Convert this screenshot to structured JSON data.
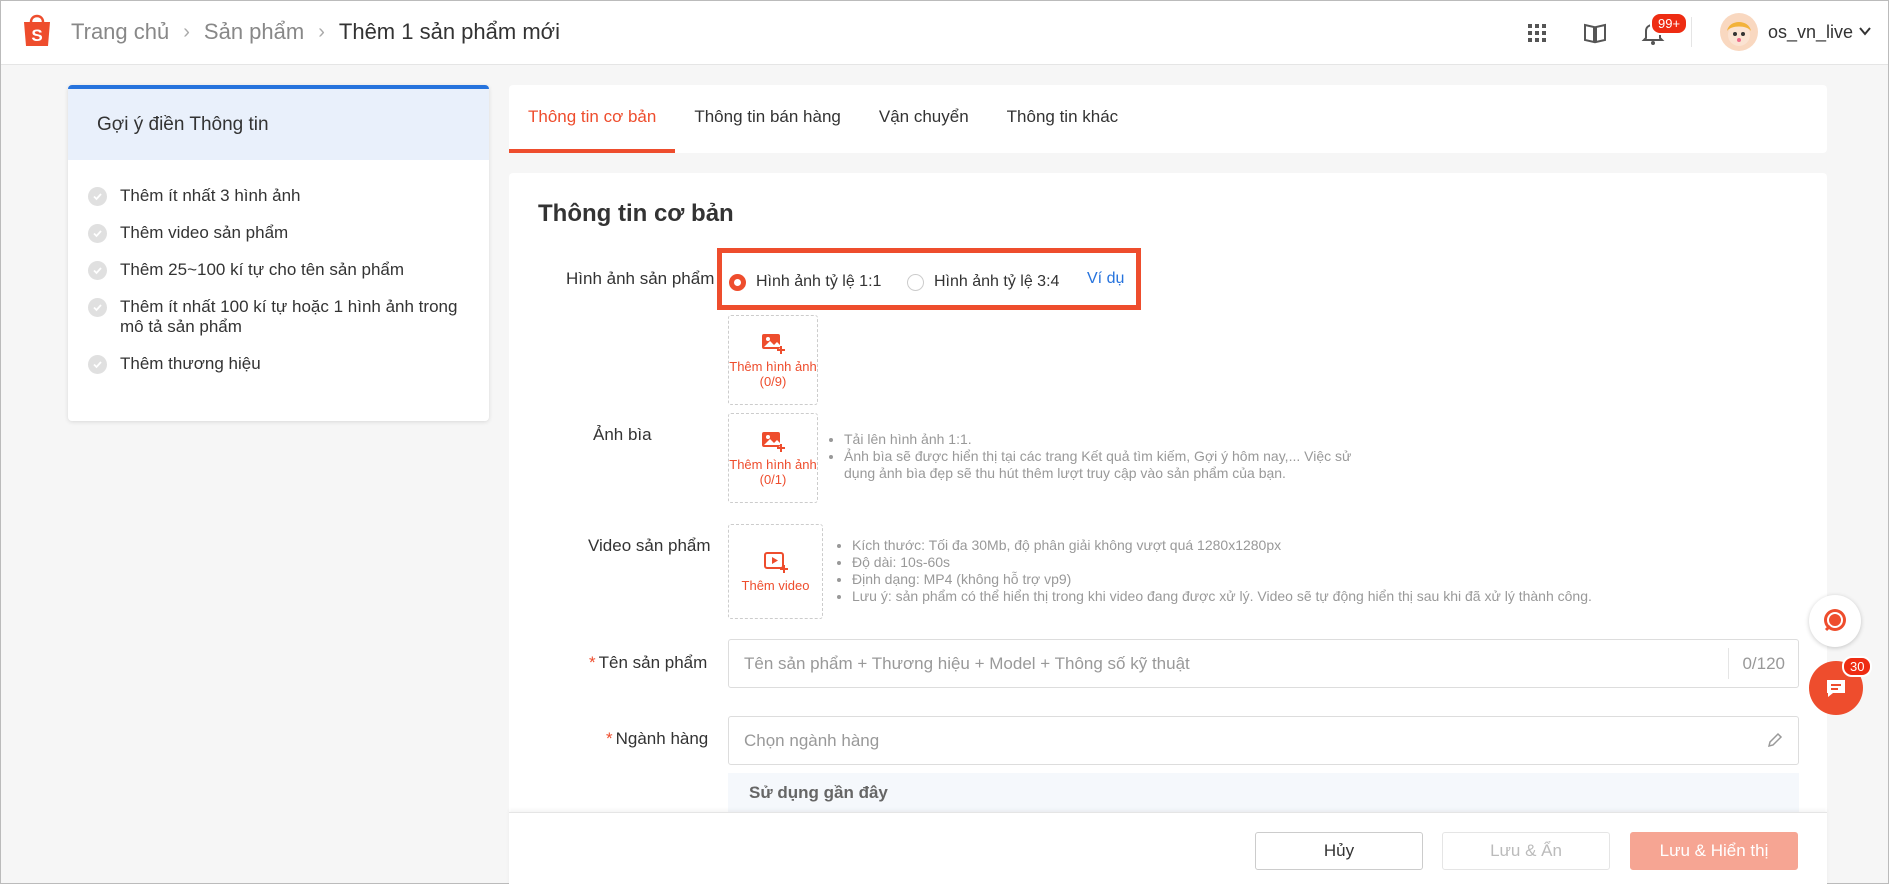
{
  "header": {
    "breadcrumb": [
      "Trang chủ",
      "Sản phẩm",
      "Thêm 1 sản phẩm mới"
    ],
    "notification_badge": "99+",
    "username": "os_vn_live"
  },
  "sidebar": {
    "title": "Gợi ý điền Thông tin",
    "items": [
      "Thêm ít nhất 3 hình ảnh",
      "Thêm video sản phẩm",
      "Thêm 25~100 kí tự cho tên sản phẩm",
      "Thêm ít nhất 100 kí tự hoặc 1 hình ảnh trong mô tả sản phẩm",
      "Thêm thương hiệu"
    ]
  },
  "tabs": [
    "Thông tin cơ bản",
    "Thông tin bán hàng",
    "Vận chuyển",
    "Thông tin khác"
  ],
  "form": {
    "section_title": "Thông tin cơ bản",
    "product_images": {
      "label": "Hình ảnh sản phẩm",
      "ratio_1_1": "Hình ảnh tỷ lệ 1:1",
      "ratio_3_4": "Hình ảnh tỷ lệ 3:4",
      "example_link": "Ví dụ",
      "upload_label": "Thêm hình ảnh (0/9)"
    },
    "cover_image": {
      "label": "Ảnh bìa",
      "upload_label": "Thêm hình ảnh (0/1)",
      "notes": [
        "Tải lên hình ảnh 1:1.",
        "Ảnh bìa sẽ được hiển thị tại các trang Kết quả tìm kiếm, Gợi ý hôm nay,... Việc sử dụng ảnh bìa đẹp sẽ thu hút thêm lượt truy cập vào sản phẩm của bạn."
      ]
    },
    "product_video": {
      "label": "Video sản phẩm",
      "upload_label": "Thêm video",
      "notes": [
        "Kích thước: Tối đa 30Mb, độ phân giải không vượt quá 1280x1280px",
        "Độ dài: 10s-60s",
        "Định dạng: MP4 (không hỗ trợ vp9)",
        "Lưu ý: sản phẩm có thể hiển thị trong khi video đang được xử lý. Video sẽ tự động hiển thị sau khi đã xử lý thành công."
      ]
    },
    "product_name": {
      "label": "Tên sản phẩm",
      "placeholder": "Tên sản phẩm + Thương hiệu + Model + Thông số kỹ thuật",
      "counter": "0/120"
    },
    "category": {
      "label": "Ngành hàng",
      "placeholder": "Chọn ngành hàng",
      "recent_title": "Sử dụng gần đây"
    }
  },
  "footer": {
    "cancel": "Hủy",
    "save_hide": "Lưu & Ẩn",
    "save_show": "Lưu & Hiển thị"
  },
  "floating": {
    "message_badge": "30"
  },
  "colors": {
    "accent": "#ee4d2d",
    "link": "#2673dd"
  }
}
